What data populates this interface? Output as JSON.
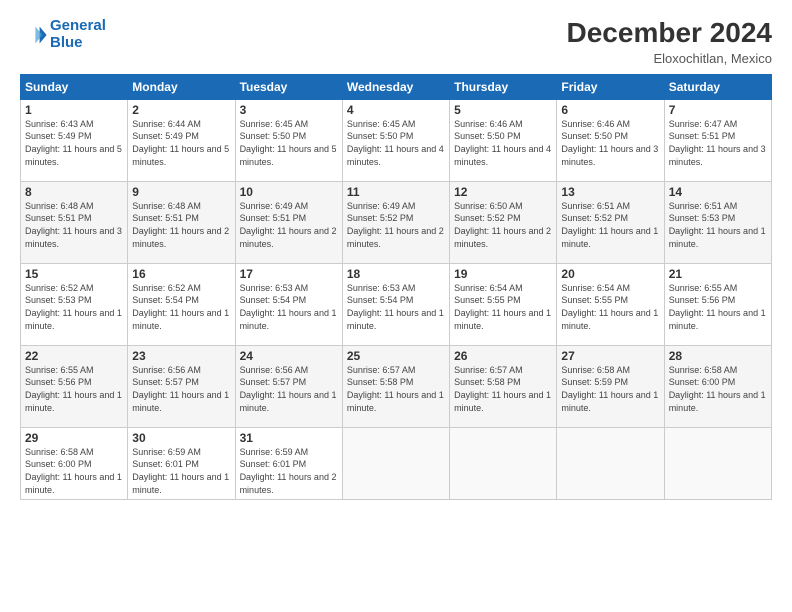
{
  "logo": {
    "line1": "General",
    "line2": "Blue"
  },
  "title": "December 2024",
  "subtitle": "Eloxochitlan, Mexico",
  "days_of_week": [
    "Sunday",
    "Monday",
    "Tuesday",
    "Wednesday",
    "Thursday",
    "Friday",
    "Saturday"
  ],
  "weeks": [
    [
      {
        "day": "1",
        "info": "Sunrise: 6:43 AM\nSunset: 5:49 PM\nDaylight: 11 hours and 5 minutes."
      },
      {
        "day": "2",
        "info": "Sunrise: 6:44 AM\nSunset: 5:49 PM\nDaylight: 11 hours and 5 minutes."
      },
      {
        "day": "3",
        "info": "Sunrise: 6:45 AM\nSunset: 5:50 PM\nDaylight: 11 hours and 5 minutes."
      },
      {
        "day": "4",
        "info": "Sunrise: 6:45 AM\nSunset: 5:50 PM\nDaylight: 11 hours and 4 minutes."
      },
      {
        "day": "5",
        "info": "Sunrise: 6:46 AM\nSunset: 5:50 PM\nDaylight: 11 hours and 4 minutes."
      },
      {
        "day": "6",
        "info": "Sunrise: 6:46 AM\nSunset: 5:50 PM\nDaylight: 11 hours and 3 minutes."
      },
      {
        "day": "7",
        "info": "Sunrise: 6:47 AM\nSunset: 5:51 PM\nDaylight: 11 hours and 3 minutes."
      }
    ],
    [
      {
        "day": "8",
        "info": "Sunrise: 6:48 AM\nSunset: 5:51 PM\nDaylight: 11 hours and 3 minutes."
      },
      {
        "day": "9",
        "info": "Sunrise: 6:48 AM\nSunset: 5:51 PM\nDaylight: 11 hours and 2 minutes."
      },
      {
        "day": "10",
        "info": "Sunrise: 6:49 AM\nSunset: 5:51 PM\nDaylight: 11 hours and 2 minutes."
      },
      {
        "day": "11",
        "info": "Sunrise: 6:49 AM\nSunset: 5:52 PM\nDaylight: 11 hours and 2 minutes."
      },
      {
        "day": "12",
        "info": "Sunrise: 6:50 AM\nSunset: 5:52 PM\nDaylight: 11 hours and 2 minutes."
      },
      {
        "day": "13",
        "info": "Sunrise: 6:51 AM\nSunset: 5:52 PM\nDaylight: 11 hours and 1 minute."
      },
      {
        "day": "14",
        "info": "Sunrise: 6:51 AM\nSunset: 5:53 PM\nDaylight: 11 hours and 1 minute."
      }
    ],
    [
      {
        "day": "15",
        "info": "Sunrise: 6:52 AM\nSunset: 5:53 PM\nDaylight: 11 hours and 1 minute."
      },
      {
        "day": "16",
        "info": "Sunrise: 6:52 AM\nSunset: 5:54 PM\nDaylight: 11 hours and 1 minute."
      },
      {
        "day": "17",
        "info": "Sunrise: 6:53 AM\nSunset: 5:54 PM\nDaylight: 11 hours and 1 minute."
      },
      {
        "day": "18",
        "info": "Sunrise: 6:53 AM\nSunset: 5:54 PM\nDaylight: 11 hours and 1 minute."
      },
      {
        "day": "19",
        "info": "Sunrise: 6:54 AM\nSunset: 5:55 PM\nDaylight: 11 hours and 1 minute."
      },
      {
        "day": "20",
        "info": "Sunrise: 6:54 AM\nSunset: 5:55 PM\nDaylight: 11 hours and 1 minute."
      },
      {
        "day": "21",
        "info": "Sunrise: 6:55 AM\nSunset: 5:56 PM\nDaylight: 11 hours and 1 minute."
      }
    ],
    [
      {
        "day": "22",
        "info": "Sunrise: 6:55 AM\nSunset: 5:56 PM\nDaylight: 11 hours and 1 minute."
      },
      {
        "day": "23",
        "info": "Sunrise: 6:56 AM\nSunset: 5:57 PM\nDaylight: 11 hours and 1 minute."
      },
      {
        "day": "24",
        "info": "Sunrise: 6:56 AM\nSunset: 5:57 PM\nDaylight: 11 hours and 1 minute."
      },
      {
        "day": "25",
        "info": "Sunrise: 6:57 AM\nSunset: 5:58 PM\nDaylight: 11 hours and 1 minute."
      },
      {
        "day": "26",
        "info": "Sunrise: 6:57 AM\nSunset: 5:58 PM\nDaylight: 11 hours and 1 minute."
      },
      {
        "day": "27",
        "info": "Sunrise: 6:58 AM\nSunset: 5:59 PM\nDaylight: 11 hours and 1 minute."
      },
      {
        "day": "28",
        "info": "Sunrise: 6:58 AM\nSunset: 6:00 PM\nDaylight: 11 hours and 1 minute."
      }
    ],
    [
      {
        "day": "29",
        "info": "Sunrise: 6:58 AM\nSunset: 6:00 PM\nDaylight: 11 hours and 1 minute."
      },
      {
        "day": "30",
        "info": "Sunrise: 6:59 AM\nSunset: 6:01 PM\nDaylight: 11 hours and 1 minute."
      },
      {
        "day": "31",
        "info": "Sunrise: 6:59 AM\nSunset: 6:01 PM\nDaylight: 11 hours and 2 minutes."
      },
      {
        "day": "",
        "info": ""
      },
      {
        "day": "",
        "info": ""
      },
      {
        "day": "",
        "info": ""
      },
      {
        "day": "",
        "info": ""
      }
    ]
  ]
}
